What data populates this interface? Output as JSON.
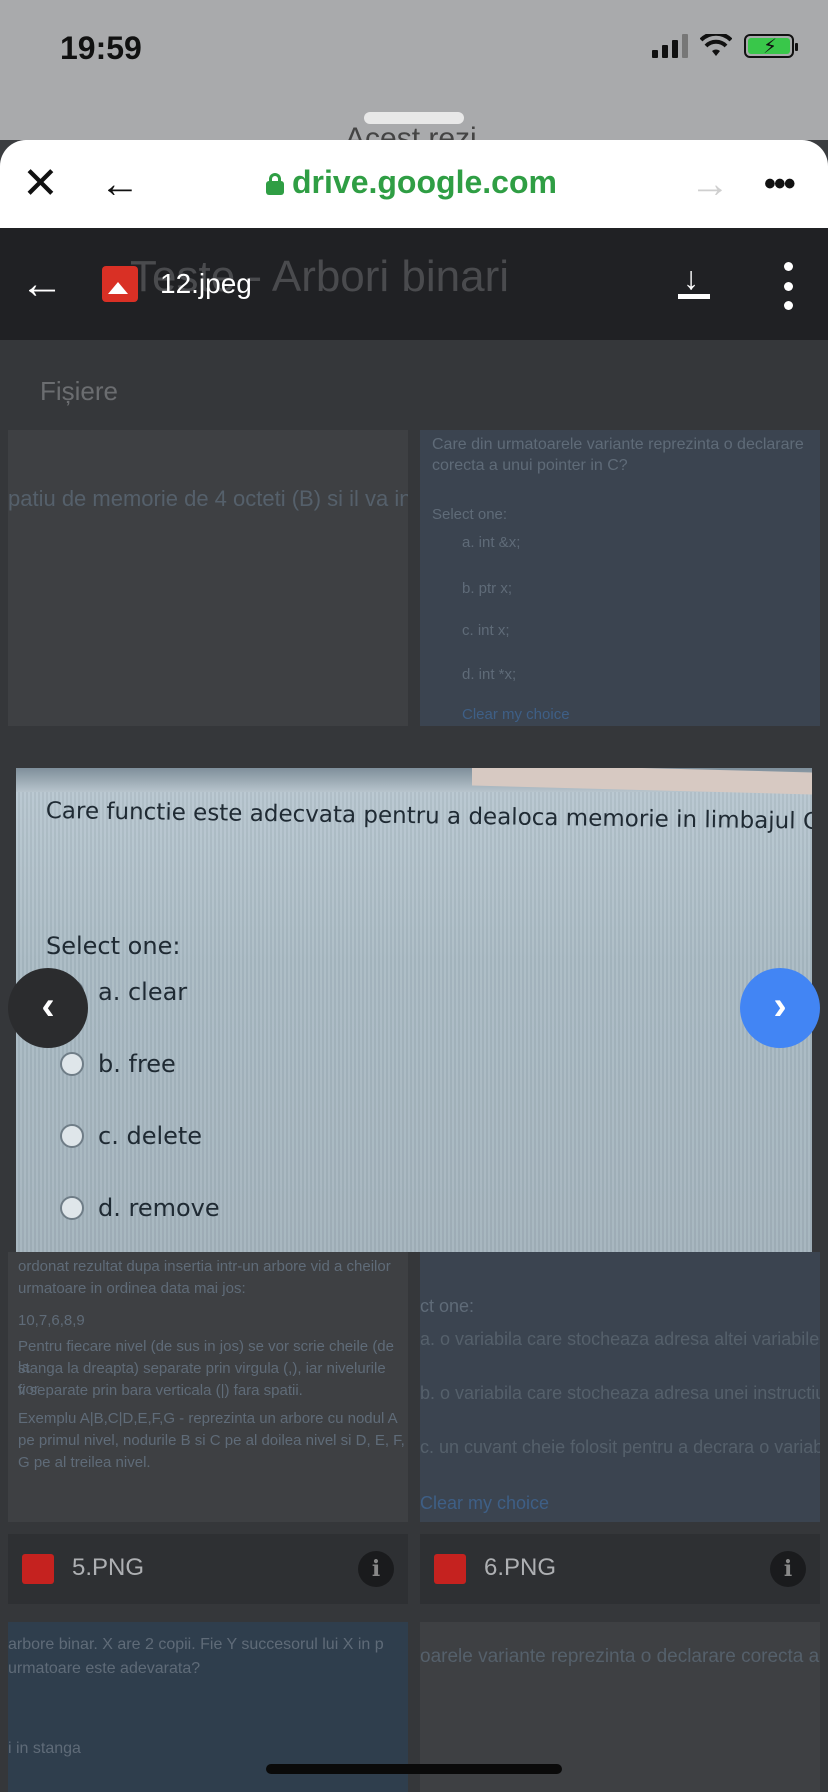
{
  "status_bar": {
    "time": "19:59"
  },
  "sheet_peek": {
    "text": "Acest rezi"
  },
  "safari": {
    "close_icon": "x-icon",
    "back_icon": "arrow-left-icon",
    "url": "drive.google.com",
    "forward_icon": "arrow-right-icon",
    "more_icon": "ellipsis-icon"
  },
  "viewer": {
    "file_name": "12.jpeg",
    "background_title": "Teste - Arbori binari"
  },
  "background": {
    "section_header": "Fișiere",
    "card1_text": "patiu de memorie de 4 octeti (B) si il va in",
    "card2_question": "Care din urmatoarele variante reprezinta o declarare corecta a unui pointer in C?",
    "card2_select": "Select one:",
    "card2_options": [
      "a. int &x;",
      "b. ptr x;",
      "c. int x;",
      "d. int *x;"
    ],
    "card2_clear": "Clear my choice",
    "card3_lines": [
      "ordonat rezultat dupa insertia intr-un arbore vid a cheilor",
      "urmatoare in ordinea data mai jos:",
      "10,7,6,8,9",
      "Pentru fiecare nivel (de sus in jos) se vor scrie cheile (de la",
      "stanga la dreapta) separate prin virgula (,), iar nivelurile vor",
      "fi separate prin bara verticala (|) fara spatii.",
      "Exemplu A|B,C|D,E,F,G - reprezinta un arbore cu nodul A",
      "pe primul nivel, nodurile B si C pe al doilea nivel si D, E, F,",
      "G pe al treilea nivel."
    ],
    "card4_select": "ct one:",
    "card4_options": [
      "a. o variabila care stocheaza adresa altei variabile",
      "b. o variabila care stocheaza adresa unei instructiuni",
      "c. un cuvant cheie folosit pentru a decrara o variabila"
    ],
    "card4_clear": "Clear my choice",
    "chip5_name": "5.PNG",
    "chip6_name": "6.PNG",
    "card5_lines": [
      "arbore binar. X are 2 copii. Fie Y succesorul lui X in p",
      "urmatoare este adevarata?",
      "",
      "i in stanga"
    ],
    "card6_line": "oarele variante reprezinta o declarare corecta a"
  },
  "image": {
    "question": "Care functie este adecvata pentru a dealoca memorie in limbajul C?",
    "select_one": "Select one:",
    "options": [
      {
        "label": "a. clear"
      },
      {
        "label": "b. free"
      },
      {
        "label": "c. delete"
      },
      {
        "label": "d. remove"
      }
    ]
  },
  "nav": {
    "prev_icon": "chevron-left-icon",
    "next_icon": "chevron-right-icon"
  }
}
